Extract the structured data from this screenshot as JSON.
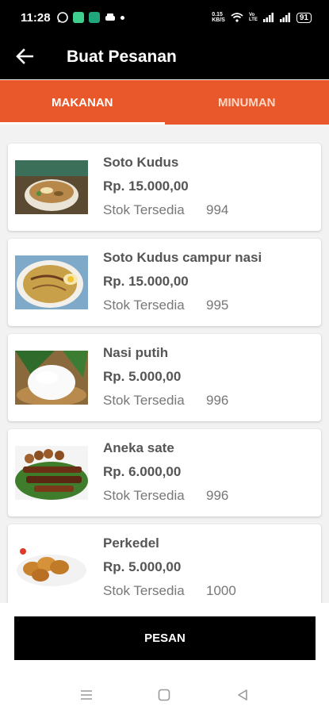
{
  "status_bar": {
    "time": "11:28",
    "network_speed": "0.15\nKB/S",
    "lte_label": "Vo\nLTE",
    "battery": "91"
  },
  "app_bar": {
    "back_icon": "arrow-left-icon",
    "title": "Buat Pesanan"
  },
  "tabs": [
    {
      "label": "MAKANAN",
      "selected": true
    },
    {
      "label": "MINUMAN",
      "selected": false
    }
  ],
  "colors": {
    "accent": "#e8582a",
    "appbar": "#000000",
    "text": "#555555"
  },
  "menu_items": [
    {
      "name": "Soto Kudus",
      "price": "Rp. 15.000,00",
      "stock_label": "Stok Tersedia",
      "stock": "994"
    },
    {
      "name": "Soto Kudus campur nasi",
      "price": "Rp. 15.000,00",
      "stock_label": "Stok Tersedia",
      "stock": "995"
    },
    {
      "name": "Nasi putih",
      "price": "Rp. 5.000,00",
      "stock_label": "Stok Tersedia",
      "stock": "996"
    },
    {
      "name": "Aneka sate",
      "price": "Rp. 6.000,00",
      "stock_label": "Stok Tersedia",
      "stock": "996"
    },
    {
      "name": "Perkedel",
      "price": "Rp. 5.000,00",
      "stock_label": "Stok Tersedia",
      "stock": "1000"
    }
  ],
  "order_button": {
    "label": "PESAN"
  },
  "nav_bar": {
    "menu_icon": "recent-apps-icon",
    "home_icon": "home-square-icon",
    "back_icon": "back-triangle-icon"
  }
}
